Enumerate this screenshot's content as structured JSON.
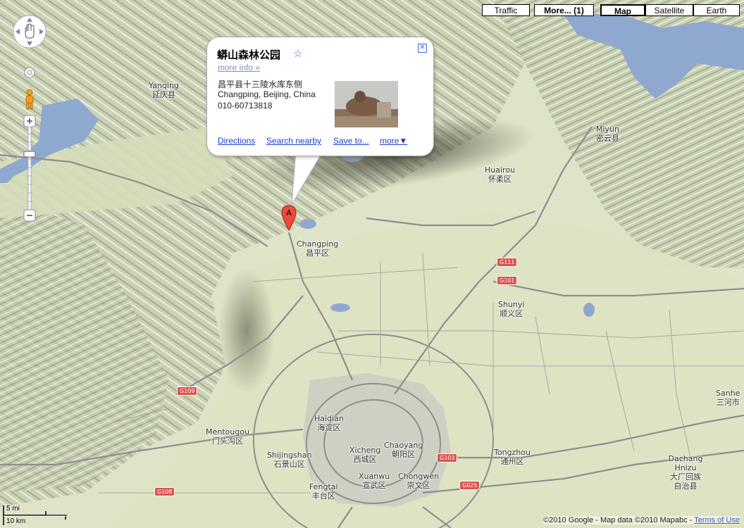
{
  "map_type_buttons": [
    {
      "label": "Traffic",
      "active": false
    },
    {
      "label": "More... (1)",
      "active": false
    },
    {
      "label": "Map",
      "active": true
    },
    {
      "label": "Satellite",
      "active": false
    },
    {
      "label": "Earth",
      "active": false
    }
  ],
  "info_window": {
    "title": "蟒山森林公园",
    "star": "☆",
    "more_info": "more info »",
    "address_lines": [
      "昌平县十三陵水库东侧",
      "Changping, Beijing, China",
      "010-60713818"
    ],
    "links": {
      "directions": "Directions",
      "search_nearby": "Search nearby",
      "save_to": "Save to...",
      "more": "more▼"
    },
    "close": "✕"
  },
  "marker": {
    "letter": "A"
  },
  "places": [
    {
      "en": "Yanqing",
      "zh": "延庆县"
    },
    {
      "en": "Miyun",
      "zh": "密云县"
    },
    {
      "en": "Huairou",
      "zh": "怀柔区"
    },
    {
      "en": "Changping",
      "zh": "昌平区"
    },
    {
      "en": "Shunyi",
      "zh": "顺义区"
    },
    {
      "en": "Sanhe",
      "zh": "三河市"
    },
    {
      "en": "Haidian",
      "zh": "海淀区"
    },
    {
      "en": "Mentougou",
      "zh": "门头沟区"
    },
    {
      "en": "Shijingshan",
      "zh": "石景山区"
    },
    {
      "en": "Xicheng",
      "zh": "西城区"
    },
    {
      "en": "Chaoyang",
      "zh": "朝阳区"
    },
    {
      "en": "Tongzhou",
      "zh": "通州区"
    },
    {
      "en": "Xuanwu",
      "zh": "宣武区"
    },
    {
      "en": "Chongwen",
      "zh": "崇文区"
    },
    {
      "en": "Fengtai",
      "zh": "丰台区"
    },
    {
      "en": "Dachang Hnizu",
      "zh": "大厂回族 自治县"
    }
  ],
  "road_shields": [
    "G111",
    "G101",
    "G109",
    "G103",
    "G025",
    "G108"
  ],
  "scale": {
    "miles": "5 mi",
    "km": "10 km"
  },
  "copyright": {
    "text": "©2010 Google - Map data ©2010 Mapabc - ",
    "terms": "Terms of Use"
  },
  "colors": {
    "land": "#d9dfc4",
    "water": "#8fa8d0",
    "road_major": "#9a9a9a",
    "urban": "#c8c8c0",
    "link": "#1a3ed1",
    "shield": "#d9534f"
  }
}
